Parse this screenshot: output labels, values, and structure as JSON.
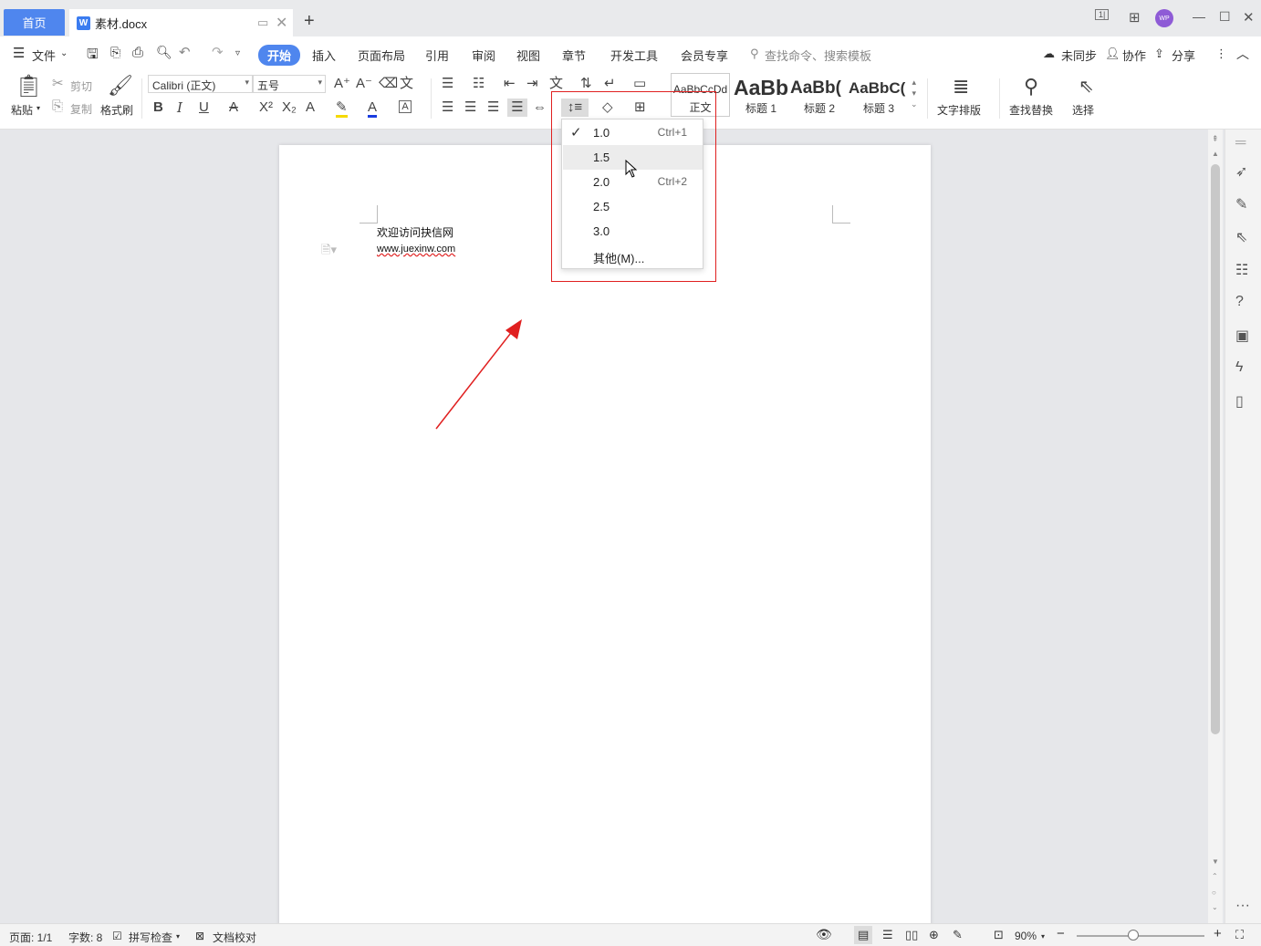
{
  "titlebar": {
    "home_tab": "首页",
    "doc_tab": "素材.docx",
    "new_tab": "+",
    "avatar": "WP"
  },
  "menubar": {
    "file": "文件",
    "tabs": [
      "开始",
      "插入",
      "页面布局",
      "引用",
      "审阅",
      "视图",
      "章节",
      "开发工具",
      "会员专享"
    ],
    "search_placeholder": "查找命令、搜索模板",
    "sync": "未同步",
    "collab": "协作",
    "share": "分享"
  },
  "ribbon": {
    "paste": "粘贴",
    "cut": "剪切",
    "copy": "复制",
    "format_painter": "格式刷",
    "font_name": "Calibri (正文)",
    "font_size": "五号",
    "styles": [
      {
        "preview": "AaBbCcDd",
        "name": "正文"
      },
      {
        "preview": "AaBb",
        "name": "标题 1"
      },
      {
        "preview": "AaBb(",
        "name": "标题 2"
      },
      {
        "preview": "AaBbC(",
        "name": "标题 3"
      }
    ],
    "text_layout": "文字排版",
    "find_replace": "查找替换",
    "select": "选择"
  },
  "line_spacing_menu": {
    "items": [
      {
        "value": "1.0",
        "shortcut": "Ctrl+1",
        "checked": true
      },
      {
        "value": "1.5",
        "shortcut": "",
        "checked": false
      },
      {
        "value": "2.0",
        "shortcut": "Ctrl+2",
        "checked": false
      },
      {
        "value": "2.5",
        "shortcut": "",
        "checked": false
      },
      {
        "value": "3.0",
        "shortcut": "",
        "checked": false
      },
      {
        "value": "其他(M)...",
        "shortcut": "",
        "checked": false
      }
    ]
  },
  "document": {
    "line1": "欢迎访问抉信网",
    "line2": "www.juexinw.com"
  },
  "statusbar": {
    "page": "页面: 1/1",
    "words": "字数: 8",
    "spell": "拼写检查",
    "proof": "文档校对",
    "zoom": "90%"
  },
  "colors": {
    "accent": "#4f86ee",
    "annotation_red": "#e02020"
  }
}
